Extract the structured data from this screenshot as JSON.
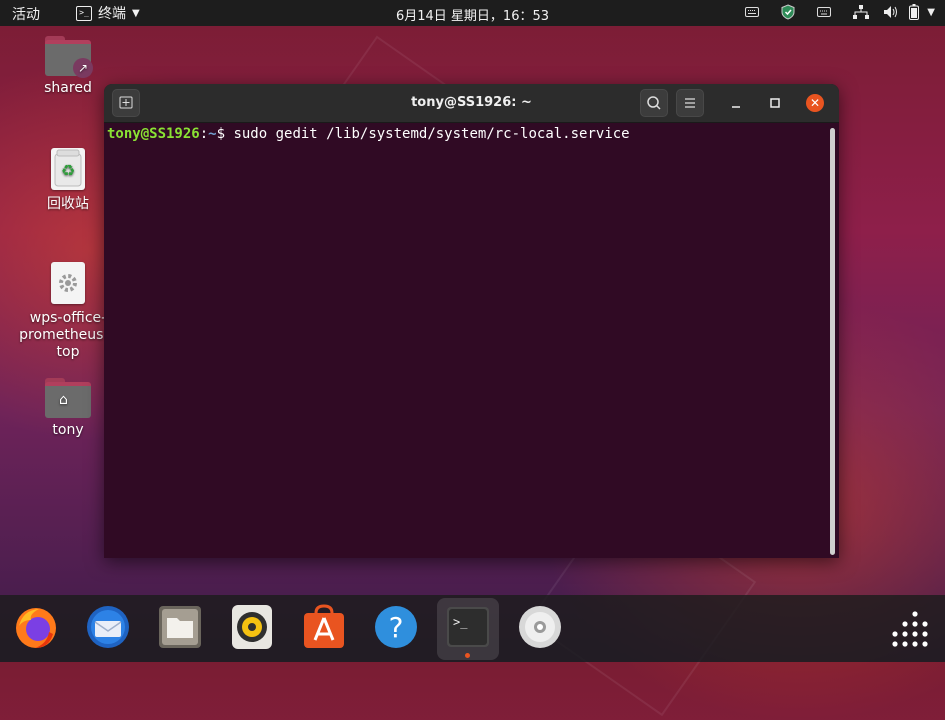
{
  "topbar": {
    "activities": "活动",
    "app_menu": "终端",
    "clock": "6月14日 星期日，16：53"
  },
  "desktop": {
    "icons": [
      {
        "label": "shared"
      },
      {
        "label": "回收站"
      },
      {
        "label": "wps-office-prometheus.desktop",
        "label_lines": [
          "wps-office-",
          "prometheus.d",
          "top"
        ]
      },
      {
        "label": "tony"
      }
    ]
  },
  "terminal": {
    "title": "tony@SS1926: ~",
    "prompt_user": "tony@SS1926",
    "prompt_sep": ":",
    "prompt_path": "~",
    "prompt_dollar": "$ ",
    "command": "sudo gedit /lib/systemd/system/rc-local.service"
  },
  "dock": {
    "apps": [
      "firefox-icon",
      "thunderbird-icon",
      "files-icon",
      "rhythmbox-icon",
      "software-center-icon",
      "help-icon",
      "terminal-icon",
      "disc-icon",
      "show-apps-icon"
    ]
  },
  "colors": {
    "accent": "#e95420",
    "terminal_bg": "#300a24",
    "prompt_user": "#8ae234",
    "prompt_path": "#729fcf"
  }
}
